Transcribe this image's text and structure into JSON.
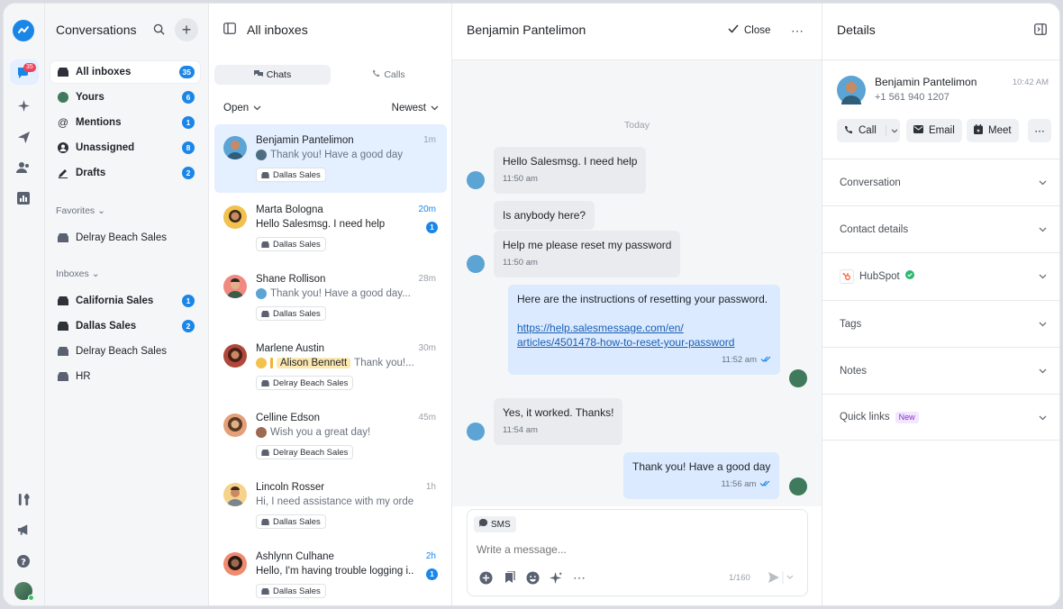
{
  "rail": {
    "badge": "35"
  },
  "sidebar": {
    "title": "Conversations",
    "items": [
      {
        "label": "All inboxes",
        "count": "35"
      },
      {
        "label": "Yours",
        "count": "6"
      },
      {
        "label": "Mentions",
        "count": "1"
      },
      {
        "label": "Unassigned",
        "count": "8"
      },
      {
        "label": "Drafts",
        "count": "2"
      }
    ],
    "favorites_label": "Favorites",
    "favorites": [
      {
        "label": "Delray Beach Sales"
      }
    ],
    "inboxes_label": "Inboxes",
    "inboxes": [
      {
        "label": "California Sales",
        "count": "1"
      },
      {
        "label": "Dallas Sales",
        "count": "2"
      },
      {
        "label": "Delray Beach Sales"
      },
      {
        "label": "HR"
      }
    ]
  },
  "list": {
    "title": "All inboxes",
    "tabs": [
      "Chats",
      "Calls"
    ],
    "filter_status": "Open",
    "filter_sort": "Newest",
    "conversations": [
      {
        "name": "Benjamin Pantelimon",
        "time": "1m",
        "preview": "Thank you! Have a good day",
        "inbox": "Dallas Sales"
      },
      {
        "name": "Marta Bologna",
        "time": "20m",
        "preview": "Hello Salesmsg. I need help",
        "inbox": "Dallas Sales",
        "unread": "1"
      },
      {
        "name": "Shane Rollison",
        "time": "28m",
        "preview": "Thank you! Have a good day...",
        "inbox": "Dallas Sales"
      },
      {
        "name": "Marlene Austin",
        "time": "30m",
        "mention": "Alison Bennett",
        "preview": "Thank you!...",
        "inbox": "Delray Beach Sales"
      },
      {
        "name": "Celline Edson",
        "time": "45m",
        "preview": "Wish you a great day!",
        "inbox": "Delray Beach Sales"
      },
      {
        "name": "Lincoln Rosser",
        "time": "1h",
        "preview": "Hi, I need assistance with my orde...",
        "inbox": "Dallas Sales"
      },
      {
        "name": "Ashlynn Culhane",
        "time": "2h",
        "preview": "Hello, I'm having trouble logging i...",
        "inbox": "Dallas Sales",
        "unread": "1"
      }
    ]
  },
  "chat": {
    "title": "Benjamin Pantelimon",
    "close_label": "Close",
    "day": "Today",
    "messages": [
      {
        "dir": "in",
        "text": "Hello Salesmsg. I need help",
        "time": "11:50 am"
      },
      {
        "dir": "in",
        "text": "Is anybody here?"
      },
      {
        "dir": "in",
        "text": "Help me please reset my password",
        "time": "11:50 am"
      },
      {
        "dir": "out",
        "text": "Here are the instructions of resetting your password.",
        "link_line1": "https://help.salesmessage.com/en/",
        "link_line2": "articles/4501478-how-to-reset-your-password",
        "time": "11:52 am"
      },
      {
        "dir": "in",
        "text": "Yes, it worked. Thanks!",
        "time": "11:54 am"
      },
      {
        "dir": "out",
        "text": "Thank you! Have a good day",
        "time": "11:56 am"
      }
    ],
    "composer": {
      "channel": "SMS",
      "placeholder": "Write a message...",
      "count": "1/160"
    }
  },
  "details": {
    "title": "Details",
    "contact_name": "Benjamin Pantelimon",
    "phone": "+1 561 940 1207",
    "time": "10:42 AM",
    "buttons": [
      "Call",
      "Email",
      "Meet"
    ],
    "sections": [
      "Conversation",
      "Contact details",
      "HubSpot",
      "Tags",
      "Notes",
      "Quick links"
    ],
    "new_badge": "New"
  },
  "colors": {
    "accent": "#1a86e8",
    "badge_red": "#f0435a",
    "selected_bg": "#e4efff",
    "outgoing_bg": "#dbeafe"
  }
}
